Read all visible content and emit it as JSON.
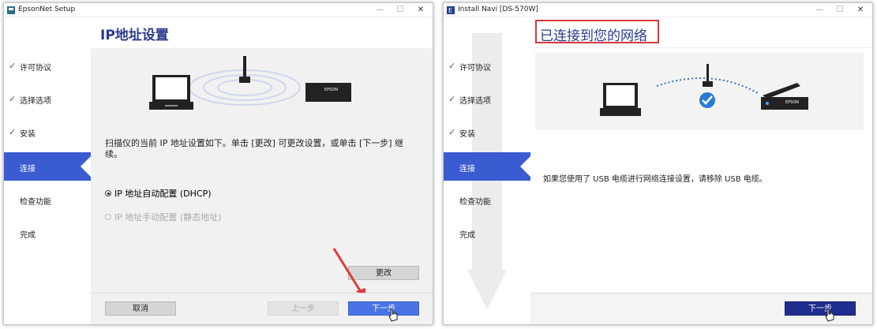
{
  "left_window": {
    "title": "EpsonNet Setup",
    "header": "IP地址设置",
    "steps": [
      {
        "label": "许可协议",
        "done": true
      },
      {
        "label": "选择选项",
        "done": true
      },
      {
        "label": "安装",
        "done": true
      },
      {
        "label": "连接",
        "active": true
      },
      {
        "label": "检查功能"
      },
      {
        "label": "完成"
      }
    ],
    "description": "扫描仪的当前 IP 地址设置如下。单击 [更改] 可更改设置，或单击 [下一步] 继续。",
    "device_brand": "EPSON",
    "radio_dhcp": "IP 地址自动配置 (DHCP)",
    "radio_static": "IP 地址手动配置 (静态地址)",
    "change_button": "更改",
    "cancel_button": "取消",
    "back_button": "上一步",
    "next_button": "下一步"
  },
  "right_window": {
    "title": "Install Navi [DS-570W]",
    "header": "已连接到您的网络",
    "steps": [
      {
        "label": "许可协议",
        "done": true
      },
      {
        "label": "选择选项",
        "done": true
      },
      {
        "label": "安装",
        "done": true
      },
      {
        "label": "连接",
        "active": true
      },
      {
        "label": "检查功能"
      },
      {
        "label": "完成"
      }
    ],
    "device_brand": "EPSON",
    "message": "如果您使用了 USB 电缆进行网络连接设置，请移除 USB 电缆。",
    "next_button": "下一步"
  },
  "colors": {
    "active_step": "#3b5bd1",
    "header_text": "#2a3a8c",
    "next_blue": "#4a74e6",
    "next_navy": "#1f2e8e",
    "highlight_red": "#d9363e"
  }
}
